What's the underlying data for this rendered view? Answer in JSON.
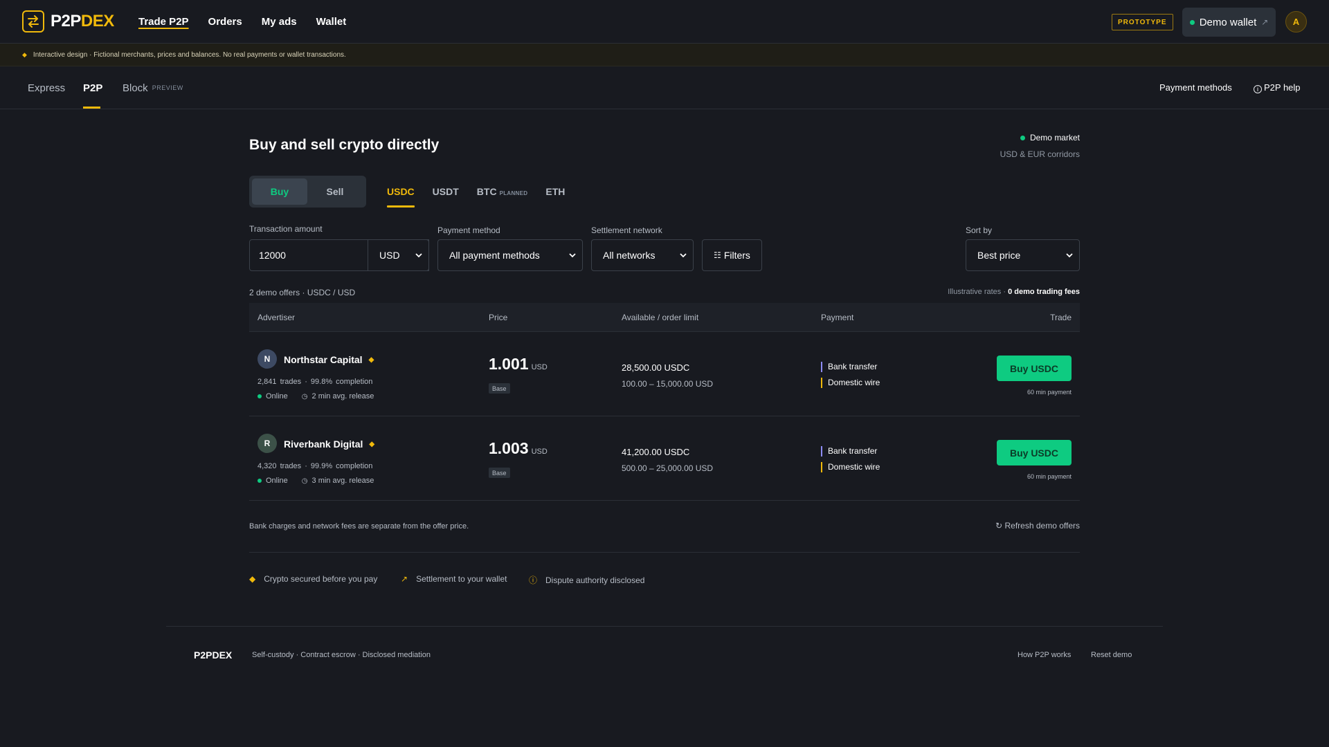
{
  "header": {
    "brand_p2p": "P2P",
    "brand_dex": "DEX",
    "nav": [
      "Trade P2P",
      "Orders",
      "My ads",
      "Wallet"
    ],
    "prototype_badge": "PROTOTYPE",
    "wallet_label": "Demo wallet",
    "wallet_ext_icon": "↗",
    "avatar_initial": "A"
  },
  "notice": {
    "icon": "◆",
    "text": "Interactive design · Fictional merchants, prices and balances. No real payments or wallet transactions."
  },
  "subnav": {
    "tabs": [
      "Express",
      "P2P",
      "Block"
    ],
    "block_tag": "PREVIEW",
    "payment_methods": "Payment methods",
    "help": "P2P help",
    "help_icon": "i"
  },
  "main": {
    "title": "Buy and sell crypto directly",
    "market_status": "Demo market",
    "market_corridors": "USD & EUR corridors",
    "side_buttons": [
      "Buy",
      "Sell"
    ],
    "assets": [
      "USDC",
      "USDT",
      "BTC",
      "ETH"
    ],
    "btc_tag": "PLANNED"
  },
  "filters": {
    "amount_label": "Transaction amount",
    "amount_value": "12000",
    "currency_value": "USD",
    "payment_label": "Payment method",
    "payment_value": "All payment methods",
    "network_label": "Settlement network",
    "network_value": "All networks",
    "filters_button": "Filters",
    "filters_icon": "☷",
    "sort_label": "Sort by",
    "sort_value": "Best price"
  },
  "summary": {
    "offer_count": "2 demo offers · USDC / USD",
    "rates_prefix": "Illustrative rates · ",
    "rates_fees": "0 demo trading fees"
  },
  "table": {
    "headers": [
      "Advertiser",
      "Price",
      "Available / order limit",
      "Payment",
      "Trade"
    ],
    "rows": [
      {
        "initial": "N",
        "name": "Northstar Capital",
        "stats": "2,841 trades · 99.8% completion",
        "status": "Online",
        "release": "2 min avg. release",
        "price": "1.001",
        "price_unit": "USD",
        "price_tag": "Base",
        "available": "28,500.00 USDC",
        "limit": "100.00 – 15,000.00 USD",
        "payments": [
          "Bank transfer",
          "Domestic wire"
        ],
        "button": "Buy USDC",
        "payment_window": "60 min payment"
      },
      {
        "initial": "R",
        "name": "Riverbank Digital",
        "stats": "4,320 trades · 99.9% completion",
        "status": "Online",
        "release": "3 min avg. release",
        "price": "1.003",
        "price_unit": "USD",
        "price_tag": "Base",
        "available": "41,200.00 USDC",
        "limit": "500.00 – 25,000.00 USD",
        "payments": [
          "Bank transfer",
          "Domestic wire"
        ],
        "button": "Buy USDC",
        "payment_window": "60 min payment"
      }
    ]
  },
  "bottom": {
    "fee_note": "Bank charges and network fees are separate from the offer price.",
    "refresh": "↻ Refresh demo offers",
    "trust": [
      "Crypto secured before you pay",
      "Settlement to your wallet",
      "Dispute authority disclosed"
    ]
  },
  "footer": {
    "brand": "P2PDEX",
    "tagline": "Self-custody · Contract escrow · Disclosed mediation",
    "links": [
      "How P2P works",
      "Reset demo"
    ]
  },
  "colors": {
    "accent": "#f0b90b",
    "buy_green": "#0ecb81",
    "background": "#181a20",
    "payment_bar_bank": "#8e8cf5",
    "payment_bar_wire": "#f0b90b",
    "avatar_n": "#3d4a63",
    "avatar_r": "#3c5148"
  }
}
